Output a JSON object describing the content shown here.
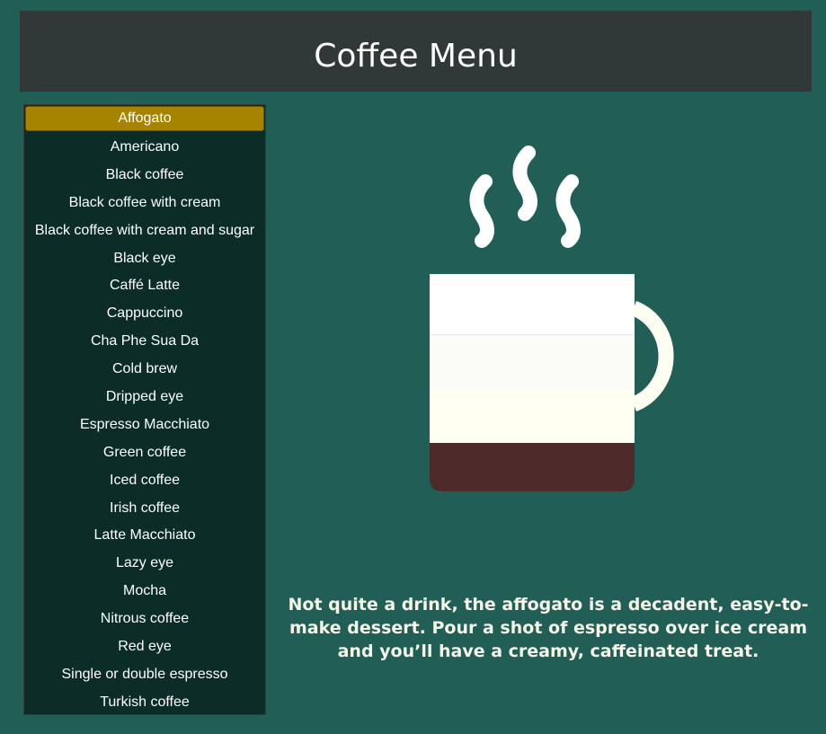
{
  "header": {
    "title": "Coffee Menu"
  },
  "menu": {
    "selected_index": 0,
    "items": [
      "Affogato",
      "Americano",
      "Black coffee",
      "Black coffee with cream",
      "Black coffee with cream and sugar",
      "Black eye",
      "Caffé Latte",
      "Cappuccino",
      "Cha Phe Sua Da",
      "Cold brew",
      "Dripped eye",
      "Espresso Macchiato",
      "Green coffee",
      "Iced coffee",
      "Irish coffee",
      "Latte Macchiato",
      "Lazy eye",
      "Mocha",
      "Nitrous coffee",
      "Red eye",
      "Single or double espresso",
      "Turkish coffee"
    ]
  },
  "illustration": {
    "icon": "coffee-cup-icon",
    "layers": [
      {
        "name": "ice cream",
        "color": "#ffffff"
      },
      {
        "name": "ice cream",
        "color": "#fbfbf7"
      },
      {
        "name": "cream",
        "color": "#fffff2"
      },
      {
        "name": "espresso",
        "color": "#4e2a2a"
      }
    ]
  },
  "description": {
    "text": "Not quite a drink, the affogato is a decadent, easy-to-make dessert. Pour a shot of espresso over ice cream and you’ll have a creamy, caffeinated treat."
  },
  "colors": {
    "background": "#215e55",
    "header": "#313838",
    "menu": "#0b2c27",
    "selected": "#a68400"
  }
}
